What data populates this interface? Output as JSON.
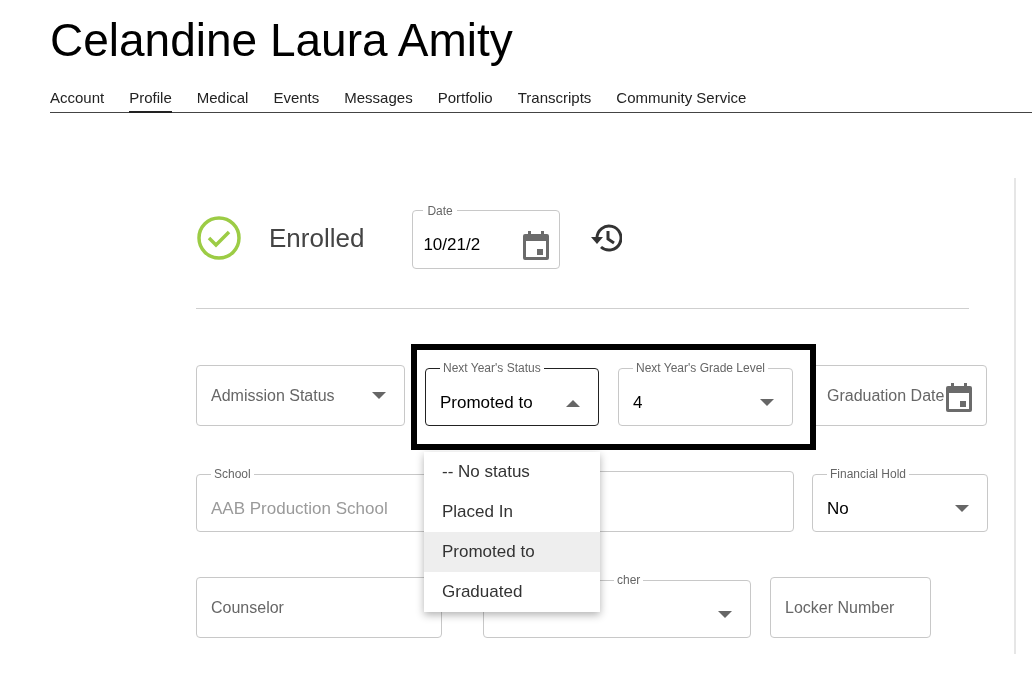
{
  "student_name": "Celandine Laura Amity",
  "tabs": [
    {
      "label": "Account",
      "selected": false
    },
    {
      "label": "Profile",
      "selected": true
    },
    {
      "label": "Medical",
      "selected": false
    },
    {
      "label": "Events",
      "selected": false
    },
    {
      "label": "Messages",
      "selected": false
    },
    {
      "label": "Portfolio",
      "selected": false
    },
    {
      "label": "Transcripts",
      "selected": false
    },
    {
      "label": "Community Service",
      "selected": false
    }
  ],
  "enrollment": {
    "status": "Enrolled",
    "date": {
      "label": "Date",
      "value": "10/21/2"
    }
  },
  "field_rows": [
    [
      {
        "kind": "select",
        "placeholder": "Admission Status"
      },
      {
        "kind": "select",
        "label": "Next Year's Status",
        "value": "Promoted to",
        "expanded": true
      },
      {
        "kind": "select",
        "label": "Next Year's Grade Level",
        "value": "4",
        "expanded": false
      },
      {
        "kind": "date",
        "placeholder": "Graduation Date"
      }
    ],
    [
      {
        "kind": "text",
        "label": "School",
        "value": "AAB Production School",
        "disabled": true
      },
      {
        "kind": "text"
      },
      {
        "kind": "select",
        "label": "Financial Hold",
        "value": "No",
        "expanded": false
      }
    ],
    [
      {
        "kind": "text",
        "placeholder": "Counselor"
      },
      {
        "kind": "select",
        "label": "cher",
        "expanded": false
      },
      {
        "kind": "text",
        "placeholder": "Locker Number"
      }
    ]
  ],
  "dropdown": {
    "options": [
      {
        "label": "-- No status",
        "selected": false
      },
      {
        "label": "Placed In",
        "selected": false
      },
      {
        "label": "Promoted to",
        "selected": true
      },
      {
        "label": "Graduated",
        "selected": false
      }
    ]
  }
}
